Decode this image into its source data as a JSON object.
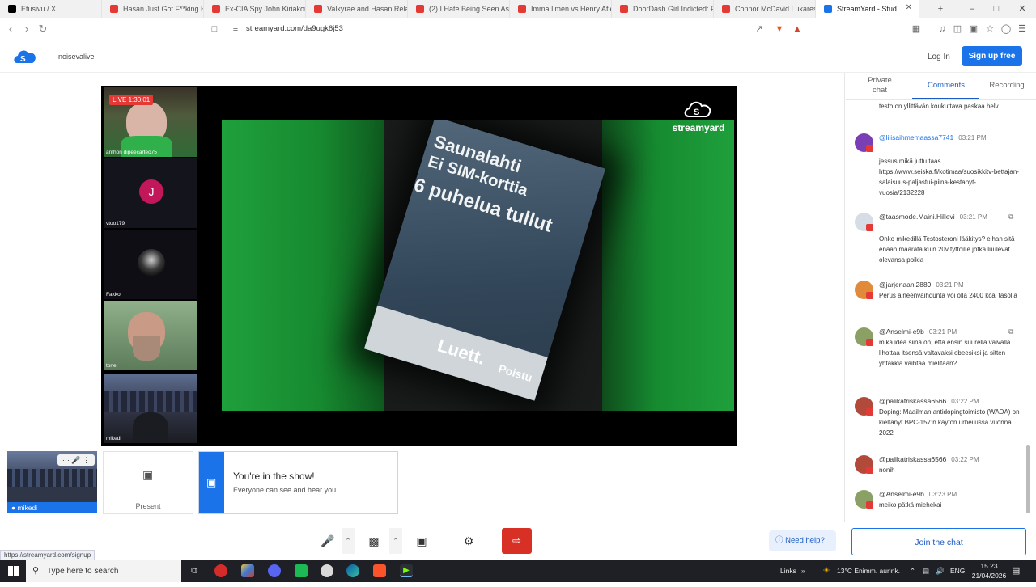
{
  "browser": {
    "tabs": [
      {
        "title": "Etusivu / X",
        "color": "#000000"
      },
      {
        "title": "Hasan Just Got F**king H...",
        "color": "#e53935"
      },
      {
        "title": "Ex-CIA Spy John Kiriakou ...",
        "color": "#e53935"
      },
      {
        "title": "Valkyrae and Hasan Relat...",
        "color": "#e53935"
      },
      {
        "title": "(2) I Hate Being Seen As Th...",
        "color": "#e53935"
      },
      {
        "title": "Imma Ilmen vs Henry Afle...",
        "color": "#e53935"
      },
      {
        "title": "DoorDash Girl Indicted: Fa...",
        "color": "#e53935"
      },
      {
        "title": "Connor McDavid Lukares...",
        "color": "#e53935"
      },
      {
        "title": "StreamYard - Stud...",
        "color": "#1a73e8"
      }
    ],
    "url": "streamyard.com/da9ugk6j53",
    "status_url": "https://streamyard.com/signup"
  },
  "header": {
    "slug": "noisevalive",
    "login_label": "Log In",
    "signup_label": "Sign up free"
  },
  "stage": {
    "live_label": "LIVE 1:30:01",
    "participants": [
      {
        "name": "anthon dipeecarteo75",
        "avatar": ""
      },
      {
        "name": "vtuo179",
        "avatar": "J"
      },
      {
        "name": "Fakko",
        "avatar": ""
      },
      {
        "name": "tone",
        "avatar": ""
      },
      {
        "name": "mikedi",
        "avatar": ""
      }
    ],
    "screen_text": {
      "line1": "Saunalahti",
      "line2": "Ei SIM-korttia",
      "line3": "6 puhelua tullut",
      "soft_left": "Luett.",
      "soft_right": "Poistu"
    },
    "watermark": "streamyard"
  },
  "bottom": {
    "self_name": "mikedi",
    "present_label": "Present",
    "inshow_title": "You're in the show!",
    "inshow_sub": "Everyone can see and hear you",
    "help_label": "Need help?"
  },
  "panel": {
    "tabs": {
      "private": "Private chat",
      "comments": "Comments",
      "recording": "Recording"
    },
    "partial_text": "testo on yllittävän koukuttava paskaa helv",
    "comments": [
      {
        "user": "@lilisaihmemaassa7741",
        "time": "03:21 PM",
        "text": "jessus mikä juttu taas https://www.seiska.fi/kotimaa/suosikkitv-bettajan-salaisuus-paljastui-piina-kestanyt-vuosia/2132228",
        "avatar_color": "#7b3fb5",
        "avatar_letter": "I"
      },
      {
        "user": "@taasmode.Maini.Hillevi",
        "time": "03:21 PM",
        "text": "Onko mikedillä Testosteroni lääkitys? eihan sitä enään määrätä kuin 20v tyttöille jotka luulevat olevansa poikia",
        "avatar_color": "#d7dde6",
        "avatar_letter": ""
      },
      {
        "user": "@jarjenaani2889",
        "time": "03:21 PM",
        "text": "Perus aineenvaihdunta voi olla 2400 kcal tasolla",
        "avatar_color": "#e08a3a",
        "avatar_letter": ""
      },
      {
        "user": "@Anselmi-e9b",
        "time": "03:21 PM",
        "text": "mikä idea siinä on, että ensin suurella vaivalla lihottaa itsensä valtavaksi obeesiksi ja sitten yhtäkkiä vaihtaa mielitään?",
        "avatar_color": "#8aa065",
        "avatar_letter": ""
      },
      {
        "user": "@palikatriskassa6566",
        "time": "03:22 PM",
        "text": "Doping: Maailman antidopingtoimisto (WADA) on kieltänyt BPC-157:n käytön urheilussa vuonna 2022",
        "avatar_color": "#b24a3c",
        "avatar_letter": ""
      },
      {
        "user": "@palikatriskassa6566",
        "time": "03:22 PM",
        "text": "nonih",
        "avatar_color": "#b24a3c",
        "avatar_letter": ""
      },
      {
        "user": "@Anselmi-e9b",
        "time": "03:23 PM",
        "text": "meiko pätkä miehekai",
        "avatar_color": "#8aa065",
        "avatar_letter": ""
      }
    ],
    "join_label": "Join the chat"
  },
  "taskbar": {
    "search_placeholder": "Type here to search",
    "links_label": "Links",
    "weather": "13°C  Enimm. aurink.",
    "lang": "ENG",
    "time": "15.23",
    "date": "21/04/2026"
  }
}
